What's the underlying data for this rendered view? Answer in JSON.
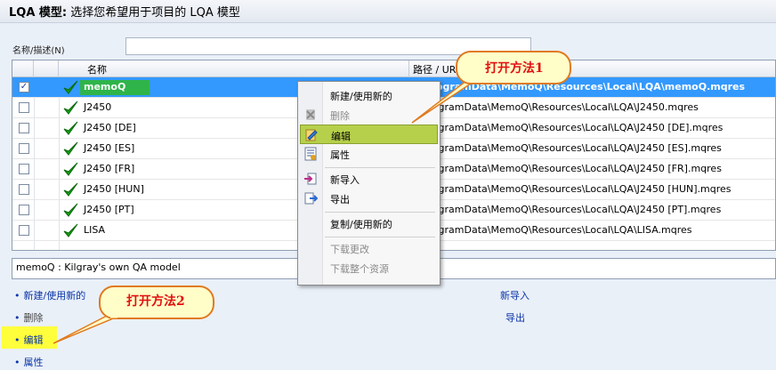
{
  "header": {
    "title_bold": "LQA 模型:",
    "title_rest": " 选择您希望用于项目的 LQA 模型"
  },
  "filter": {
    "label": "名称/描述(N)",
    "value": ""
  },
  "grid": {
    "columns": {
      "name": "名称",
      "path": "路径 / URI"
    },
    "rows": [
      {
        "checked": true,
        "name": "memoQ",
        "path": "C:\\ProgramData\\MemoQ\\Resources\\Local\\LQA\\memoQ.mqres",
        "selected": true
      },
      {
        "checked": false,
        "name": "J2450",
        "path": "C:\\ProgramData\\MemoQ\\Resources\\Local\\LQA\\J2450.mqres",
        "selected": false
      },
      {
        "checked": false,
        "name": "J2450 [DE]",
        "path": "C:\\ProgramData\\MemoQ\\Resources\\Local\\LQA\\J2450 [DE].mqres",
        "selected": false
      },
      {
        "checked": false,
        "name": "J2450 [ES]",
        "path": "C:\\ProgramData\\MemoQ\\Resources\\Local\\LQA\\J2450 [ES].mqres",
        "selected": false
      },
      {
        "checked": false,
        "name": "J2450 [FR]",
        "path": "C:\\ProgramData\\MemoQ\\Resources\\Local\\LQA\\J2450 [FR].mqres",
        "selected": false
      },
      {
        "checked": false,
        "name": "J2450 [HUN]",
        "path": "C:\\ProgramData\\MemoQ\\Resources\\Local\\LQA\\J2450 [HUN].mqres",
        "selected": false
      },
      {
        "checked": false,
        "name": "J2450 [PT]",
        "path": "C:\\ProgramData\\MemoQ\\Resources\\Local\\LQA\\J2450 [PT].mqres",
        "selected": false
      },
      {
        "checked": false,
        "name": "LISA",
        "path": "C:\\ProgramData\\MemoQ\\Resources\\Local\\LQA\\LISA.mqres",
        "selected": false
      }
    ]
  },
  "description": "memoQ : Kilgray's own QA model",
  "actions": {
    "new_use": "新建/使用新的",
    "delete": "删除",
    "edit": "编辑",
    "properties": "属性",
    "import": "新导入",
    "export": "导出",
    "bullet": "•"
  },
  "context_menu": {
    "new_use": "新建/使用新的",
    "delete": "删除",
    "edit": "编辑",
    "properties": "属性",
    "import": "新导入",
    "export": "导出",
    "clone": "复制/使用新的",
    "download_updates": "下载更改",
    "download_resource": "下载整个资源"
  },
  "callouts": {
    "method1": "打开方法1",
    "method2": "打开方法2"
  },
  "colors": {
    "selection": "#3399ff",
    "highlight_green": "#2fb44a",
    "menu_hover": "#b6d04c",
    "callout_fill": "#fffdc8",
    "callout_border": "#e07a20",
    "link": "#0b35a8"
  }
}
